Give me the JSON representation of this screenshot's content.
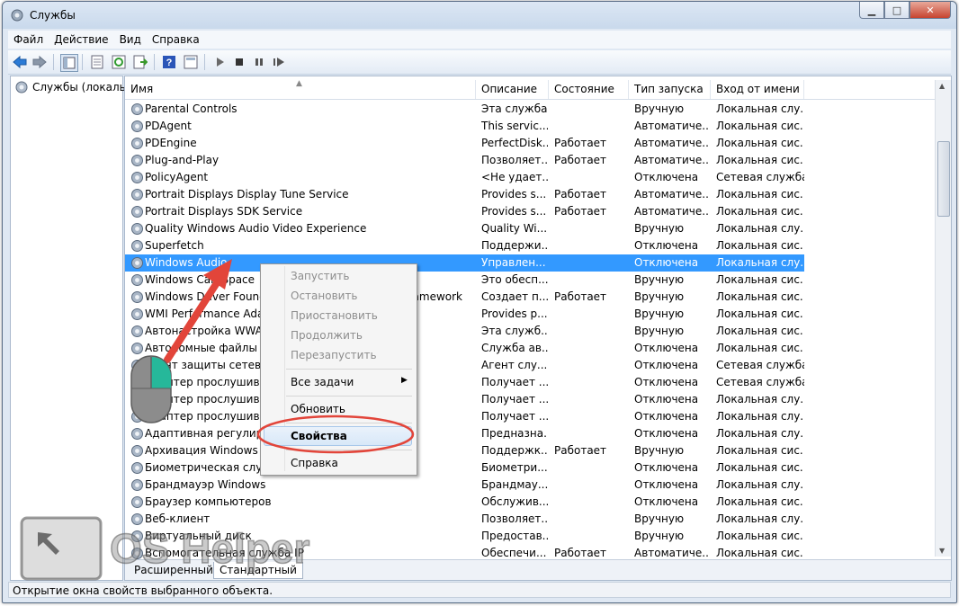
{
  "window": {
    "title": "Службы"
  },
  "menubar": [
    "Файл",
    "Действие",
    "Вид",
    "Справка"
  ],
  "toolbar": {
    "icons": [
      "back-arrow-icon",
      "forward-arrow-icon",
      "console-tree-icon",
      "properties-icon",
      "refresh-icon",
      "export-icon",
      "help-icon",
      "details-pane-icon",
      "start-service-icon",
      "stop-service-icon",
      "pause-service-icon",
      "restart-service-icon"
    ]
  },
  "tree": {
    "root_label": "Службы (локалы"
  },
  "columns": {
    "name": "Имя",
    "description": "Описание",
    "status": "Состояние",
    "startup": "Тип запуска",
    "logon": "Вход от имени"
  },
  "services": [
    {
      "name": "Parental Controls",
      "description": "Эта служба ...",
      "status": "",
      "startup": "Вручную",
      "logon": "Локальная слу..."
    },
    {
      "name": "PDAgent",
      "description": "This servic...",
      "status": "",
      "startup": "Автоматиче...",
      "logon": "Локальная сис..."
    },
    {
      "name": "PDEngine",
      "description": "PerfectDisk...",
      "status": "Работает",
      "startup": "Автоматиче...",
      "logon": "Локальная сис..."
    },
    {
      "name": "Plug-and-Play",
      "description": "Позволяет...",
      "status": "Работает",
      "startup": "Автоматиче...",
      "logon": "Локальная сис..."
    },
    {
      "name": "PolicyAgent",
      "description": "<Не удает...",
      "status": "",
      "startup": "Отключена",
      "logon": "Сетевая служба"
    },
    {
      "name": "Portrait Displays Display Tune Service",
      "description": "Provides s...",
      "status": "Работает",
      "startup": "Автоматиче...",
      "logon": "Локальная сис..."
    },
    {
      "name": "Portrait Displays SDK Service",
      "description": "Provides s...",
      "status": "Работает",
      "startup": "Автоматиче...",
      "logon": "Локальная сис..."
    },
    {
      "name": "Quality Windows Audio Video Experience",
      "description": "Quality Wi...",
      "status": "",
      "startup": "Вручную",
      "logon": "Локальная слу..."
    },
    {
      "name": "Superfetch",
      "description": "Поддержи...",
      "status": "",
      "startup": "Отключена",
      "logon": "Локальная сис..."
    },
    {
      "name": "Windows Audio",
      "description": "Управлен...",
      "status": "",
      "startup": "Отключена",
      "logon": "Локальная слу..."
    },
    {
      "name": "Windows CardSpace",
      "description": "Это обесп...",
      "status": "",
      "startup": "Вручную",
      "logon": "Локальная сис..."
    },
    {
      "name": "Windows Driver Foundation - User-mode Driver Framework",
      "description": "Создает п...",
      "status": "Работает",
      "startup": "Вручную",
      "logon": "Локальная сис..."
    },
    {
      "name": "WMI Performance Adapter",
      "description": "Provides p...",
      "status": "",
      "startup": "Вручную",
      "logon": "Локальная сис..."
    },
    {
      "name": "Автонастройка WWAN",
      "description": "Эта служб...",
      "status": "",
      "startup": "Вручную",
      "logon": "Локальная сис..."
    },
    {
      "name": "Автономные файлы",
      "description": "Служба ав...",
      "status": "",
      "startup": "Отключена",
      "logon": "Локальная сис..."
    },
    {
      "name": "Агент защиты сетевого доступа",
      "description": "Агент слу...",
      "status": "",
      "startup": "Отключена",
      "logon": "Сетевая служба"
    },
    {
      "name": "Адаптер прослушивателя Net.Msmq",
      "description": "Получает ...",
      "status": "",
      "startup": "Отключена",
      "logon": "Сетевая служба"
    },
    {
      "name": "Адаптер прослушивателя Net.Pipe",
      "description": "Получает ...",
      "status": "",
      "startup": "Отключена",
      "logon": "Локальная слу..."
    },
    {
      "name": "Адаптер прослушивателя Net.Tcp",
      "description": "Получает ...",
      "status": "",
      "startup": "Отключена",
      "logon": "Локальная слу..."
    },
    {
      "name": "Адаптивная регулировка яркости",
      "description": "Предназна...",
      "status": "",
      "startup": "Отключена",
      "logon": "Локальная слу..."
    },
    {
      "name": "Архивация Windows",
      "description": "Поддержк...",
      "status": "Работает",
      "startup": "Вручную",
      "logon": "Локальная сис..."
    },
    {
      "name": "Биометрическая служба Windows",
      "description": "Биометри...",
      "status": "",
      "startup": "Отключена",
      "logon": "Локальная сис..."
    },
    {
      "name": "Брандмауэр Windows",
      "description": "Брандмау...",
      "status": "",
      "startup": "Отключена",
      "logon": "Локальная слу..."
    },
    {
      "name": "Браузер компьютеров",
      "description": "Обслужив...",
      "status": "",
      "startup": "Отключена",
      "logon": "Локальная сис..."
    },
    {
      "name": "Веб-клиент",
      "description": "Позволяет...",
      "status": "",
      "startup": "Вручную",
      "logon": "Локальная слу..."
    },
    {
      "name": "Виртуальный диск",
      "description": "Предостав...",
      "status": "",
      "startup": "Вручную",
      "logon": "Локальная сис..."
    },
    {
      "name": "Вспомогательная служба IP",
      "description": "Обеспечи...",
      "status": "Работает",
      "startup": "Автоматиче...",
      "logon": "Локальная сис..."
    }
  ],
  "context_menu": {
    "start": "Запустить",
    "stop": "Остановить",
    "pause": "Приостановить",
    "resume": "Продолжить",
    "restart": "Перезапустить",
    "all_tasks": "Все задачи",
    "refresh": "Обновить",
    "properties": "Свойства",
    "help": "Справка"
  },
  "tabs": [
    "Расширенный",
    "Стандартный"
  ],
  "statusbar": "Открытие окна свойств выбранного объекта.",
  "watermark": {
    "brand": "OS Helper"
  },
  "colors": {
    "selection": "#3399ff",
    "annotation_red": "#e2453a",
    "window_frame": "#dfe8f3"
  }
}
